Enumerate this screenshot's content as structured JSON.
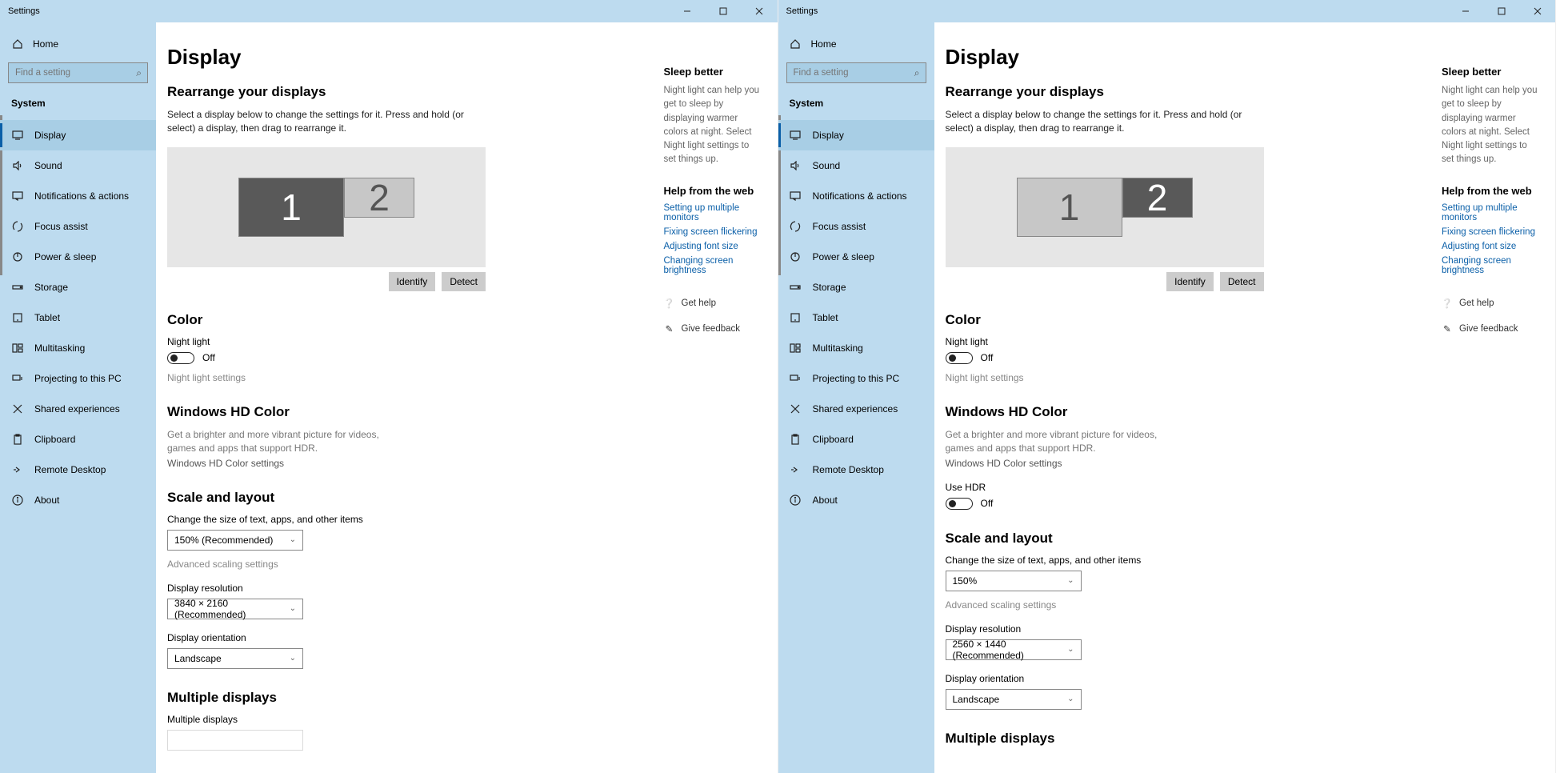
{
  "app_title": "Settings",
  "home_label": "Home",
  "search_placeholder": "Find a setting",
  "category": "System",
  "sidebar_items": [
    {
      "label": "Display"
    },
    {
      "label": "Sound"
    },
    {
      "label": "Notifications & actions"
    },
    {
      "label": "Focus assist"
    },
    {
      "label": "Power & sleep"
    },
    {
      "label": "Storage"
    },
    {
      "label": "Tablet"
    },
    {
      "label": "Multitasking"
    },
    {
      "label": "Projecting to this PC"
    },
    {
      "label": "Shared experiences"
    },
    {
      "label": "Clipboard"
    },
    {
      "label": "Remote Desktop"
    },
    {
      "label": "About"
    }
  ],
  "page_title": "Display",
  "rearrange": {
    "title": "Rearrange your displays",
    "desc": "Select a display below to change the settings for it. Press and hold (or select) a display, then drag to rearrange it.",
    "identify": "Identify",
    "detect": "Detect",
    "mon1": "1",
    "mon2": "2"
  },
  "color": {
    "title": "Color",
    "night_label": "Night light",
    "off": "Off",
    "settings": "Night light settings"
  },
  "hd": {
    "title": "Windows HD Color",
    "desc": "Get a brighter and more vibrant picture for videos, games and apps that support HDR.",
    "link": "Windows HD Color settings",
    "use_hdr": "Use HDR",
    "off": "Off"
  },
  "scale": {
    "title": "Scale and layout",
    "size_label": "Change the size of text, apps, and other items",
    "adv": "Advanced scaling settings",
    "res_label": "Display resolution",
    "orient_label": "Display orientation",
    "orient_val": "Landscape"
  },
  "left_window": {
    "scale_val": "150% (Recommended)",
    "res_val": "3840 × 2160 (Recommended)"
  },
  "right_window": {
    "scale_val": "150%",
    "res_val": "2560 × 1440 (Recommended)"
  },
  "multi": {
    "title": "Multiple displays",
    "label": "Multiple displays"
  },
  "info": {
    "sleep_title": "Sleep better",
    "sleep_desc": "Night light can help you get to sleep by displaying warmer colors at night. Select Night light settings to set things up.",
    "help_title": "Help from the web",
    "links": [
      "Setting up multiple monitors",
      "Fixing screen flickering",
      "Adjusting font size",
      "Changing screen brightness"
    ],
    "get_help": "Get help",
    "feedback": "Give feedback"
  }
}
